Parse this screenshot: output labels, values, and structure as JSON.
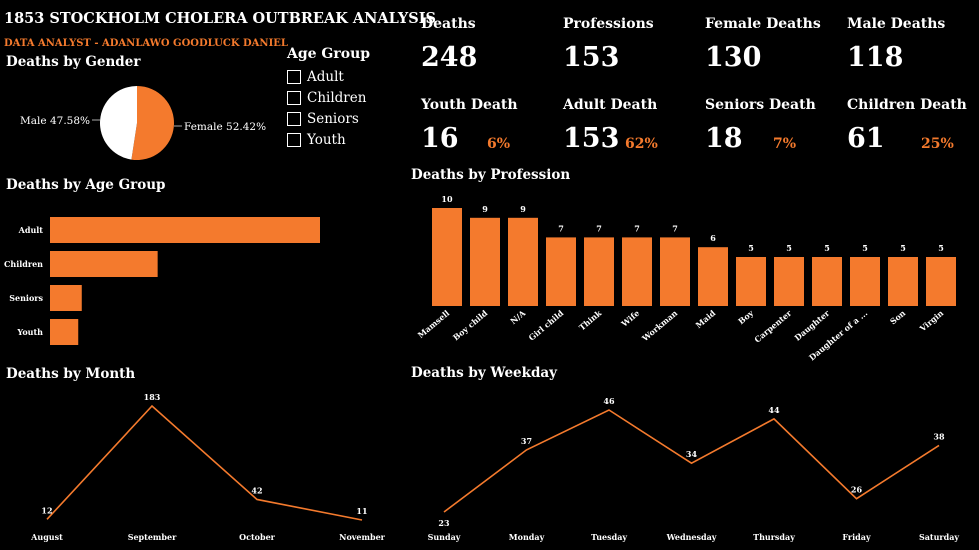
{
  "header": {
    "title": "1853 STOCKHOLM CHOLERA OUTBREAK ANALYSIS",
    "subtitle": "DATA ANALYST - ADANLAWO GOODLUCK DANIEL"
  },
  "slicer": {
    "title": "Age Group",
    "items": [
      "Adult",
      "Children",
      "Seniors",
      "Youth"
    ]
  },
  "kpis_top": [
    {
      "label": "Deaths",
      "value": "248"
    },
    {
      "label": "Professions",
      "value": "153"
    },
    {
      "label": "Female Deaths",
      "value": "130"
    },
    {
      "label": "Male Deaths",
      "value": "118"
    }
  ],
  "kpis_bottom": [
    {
      "label": "Youth Death",
      "value": "16",
      "pct": "6%"
    },
    {
      "label": "Adult Death",
      "value": "153",
      "pct": "62%"
    },
    {
      "label": "Seniors Death",
      "value": "18",
      "pct": "7%"
    },
    {
      "label": "Children Death",
      "value": "61",
      "pct": "25%"
    }
  ],
  "colors": {
    "accent": "#f47a2d",
    "background": "#000000",
    "text": "#ffffff"
  },
  "chart_data": [
    {
      "id": "gender",
      "type": "pie",
      "title": "Deaths by Gender",
      "categories": [
        "Male",
        "Female"
      ],
      "values": [
        47.58,
        52.42
      ],
      "labels": [
        "Male 47.58%",
        "Female 52.42%"
      ],
      "colors": [
        "#ffffff",
        "#f47a2d"
      ]
    },
    {
      "id": "age",
      "type": "bar",
      "orientation": "horizontal",
      "title": "Deaths by Age Group",
      "categories": [
        "Adult",
        "Children",
        "Seniors",
        "Youth"
      ],
      "values": [
        153,
        61,
        18,
        16
      ]
    },
    {
      "id": "profession",
      "type": "bar",
      "title": "Deaths by Profession",
      "categories": [
        "Mamsell",
        "Boy child",
        "N/A",
        "Girl child",
        "Think",
        "Wife",
        "Workman",
        "Maid",
        "Boy",
        "Carpenter",
        "Daughter",
        "Daughter of a ...",
        "Son",
        "Virgin"
      ],
      "values": [
        10,
        9,
        9,
        7,
        7,
        7,
        7,
        6,
        5,
        5,
        5,
        5,
        5,
        5
      ]
    },
    {
      "id": "month",
      "type": "line",
      "title": "Deaths by Month",
      "categories": [
        "August",
        "September",
        "October",
        "November"
      ],
      "values": [
        12,
        183,
        42,
        11
      ]
    },
    {
      "id": "weekday",
      "type": "line",
      "title": "Deaths by Weekday",
      "categories": [
        "Sunday",
        "Monday",
        "Tuesday",
        "Wednesday",
        "Thursday",
        "Friday",
        "Saturday"
      ],
      "values": [
        23,
        37,
        46,
        34,
        44,
        26,
        38
      ]
    }
  ]
}
